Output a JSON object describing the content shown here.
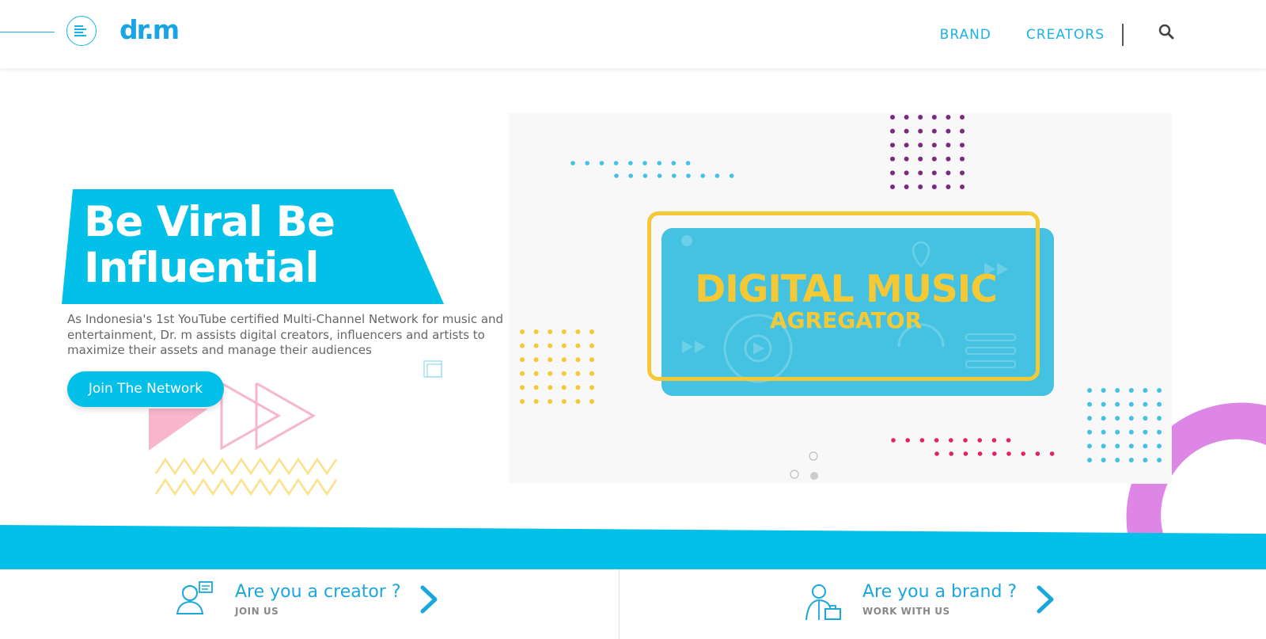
{
  "header": {
    "logo": "dr.m",
    "nav": [
      "BRAND",
      "CREATORS"
    ],
    "search_icon": "search-icon",
    "menu_icon": "menu-icon"
  },
  "hero": {
    "title_line1": "Be Viral Be",
    "title_line2": "Influential",
    "description": "As Indonesia's 1st YouTube certified Multi-Channel Network for music and entertainment, Dr. m assists digital creators, influencers and artists to maximize their assets and manage their audiences",
    "join_button": "Join The Network"
  },
  "media": {
    "title": "DIGITAL MUSIC",
    "subtitle": "AGREGATOR"
  },
  "cta": {
    "creator": {
      "title": "Are you a creator ?",
      "sub": "JOIN US"
    },
    "brand": {
      "title": "Are you a brand ?",
      "sub": "WORK WITH US"
    }
  },
  "colors": {
    "primary": "#03c0e8",
    "yellow": "#f5c935",
    "pink": "#f7b6cc",
    "purple": "#dd86e6",
    "magenta": "#7a2a7f",
    "red": "#e3245c"
  }
}
